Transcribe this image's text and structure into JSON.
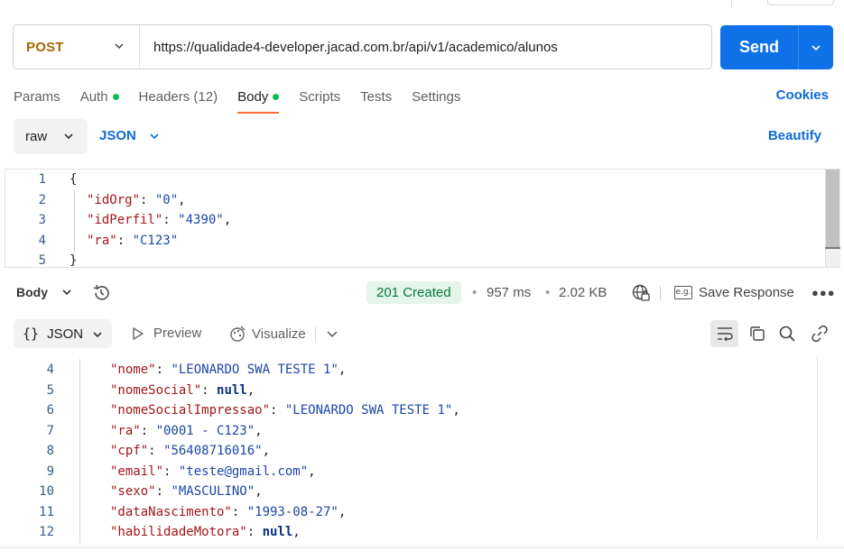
{
  "request": {
    "method": "POST",
    "url": "https://qualidade4-developer.jacad.com.br/api/v1/academico/alunos",
    "send_label": "Send"
  },
  "tabs": [
    {
      "label": "Params",
      "dot": false,
      "active": false
    },
    {
      "label": "Auth",
      "dot": true,
      "active": false
    },
    {
      "label": "Headers (12)",
      "dot": false,
      "active": false
    },
    {
      "label": "Body",
      "dot": true,
      "active": true
    },
    {
      "label": "Scripts",
      "dot": false,
      "active": false
    },
    {
      "label": "Tests",
      "dot": false,
      "active": false
    },
    {
      "label": "Settings",
      "dot": false,
      "active": false
    }
  ],
  "cookies_label": "Cookies",
  "body_mode": {
    "raw_label": "raw",
    "format_label": "JSON",
    "beautify_label": "Beautify"
  },
  "request_body": [
    {
      "n": "1",
      "parts": [
        {
          "t": "{",
          "c": "p"
        }
      ]
    },
    {
      "n": "2",
      "parts": [
        {
          "t": "\"idOrg\"",
          "c": "k"
        },
        {
          "t": ": ",
          "c": "p"
        },
        {
          "t": "\"0\"",
          "c": "s"
        },
        {
          "t": ",",
          "c": "p"
        }
      ]
    },
    {
      "n": "3",
      "parts": [
        {
          "t": "\"idPerfil\"",
          "c": "k"
        },
        {
          "t": ": ",
          "c": "p"
        },
        {
          "t": "\"4390\"",
          "c": "s"
        },
        {
          "t": ",",
          "c": "p"
        }
      ]
    },
    {
      "n": "4",
      "parts": [
        {
          "t": "\"ra\"",
          "c": "k"
        },
        {
          "t": ": ",
          "c": "p"
        },
        {
          "t": "\"C123\"",
          "c": "s"
        }
      ]
    },
    {
      "n": "5",
      "parts": [
        {
          "t": "}",
          "c": "p"
        }
      ]
    }
  ],
  "response": {
    "body_label": "Body",
    "status": "201 Created",
    "time": "957 ms",
    "size": "2.02 KB",
    "save_label": "Save Response",
    "format_label": "JSON",
    "preview_label": "Preview",
    "visualize_label": "Visualize",
    "eg_label": "e.g.",
    "lines": [
      {
        "n": "4",
        "parts": [
          {
            "t": "\"nome\"",
            "c": "k"
          },
          {
            "t": ": ",
            "c": "p"
          },
          {
            "t": "\"LEONARDO SWA TESTE 1\"",
            "c": "s"
          },
          {
            "t": ",",
            "c": "p"
          }
        ]
      },
      {
        "n": "5",
        "parts": [
          {
            "t": "\"nomeSocial\"",
            "c": "k"
          },
          {
            "t": ": ",
            "c": "p"
          },
          {
            "t": "null",
            "c": "n"
          },
          {
            "t": ",",
            "c": "p"
          }
        ]
      },
      {
        "n": "6",
        "parts": [
          {
            "t": "\"nomeSocialImpressao\"",
            "c": "k"
          },
          {
            "t": ": ",
            "c": "p"
          },
          {
            "t": "\"LEONARDO SWA TESTE 1\"",
            "c": "s"
          },
          {
            "t": ",",
            "c": "p"
          }
        ]
      },
      {
        "n": "7",
        "parts": [
          {
            "t": "\"ra\"",
            "c": "k"
          },
          {
            "t": ": ",
            "c": "p"
          },
          {
            "t": "\"0001 - C123\"",
            "c": "s"
          },
          {
            "t": ",",
            "c": "p"
          }
        ]
      },
      {
        "n": "8",
        "parts": [
          {
            "t": "\"cpf\"",
            "c": "k"
          },
          {
            "t": ": ",
            "c": "p"
          },
          {
            "t": "\"56408716016\"",
            "c": "s"
          },
          {
            "t": ",",
            "c": "p"
          }
        ]
      },
      {
        "n": "9",
        "parts": [
          {
            "t": "\"email\"",
            "c": "k"
          },
          {
            "t": ": ",
            "c": "p"
          },
          {
            "t": "\"teste@gmail.com\"",
            "c": "s"
          },
          {
            "t": ",",
            "c": "p"
          }
        ]
      },
      {
        "n": "10",
        "parts": [
          {
            "t": "\"sexo\"",
            "c": "k"
          },
          {
            "t": ": ",
            "c": "p"
          },
          {
            "t": "\"MASCULINO\"",
            "c": "s"
          },
          {
            "t": ",",
            "c": "p"
          }
        ]
      },
      {
        "n": "11",
        "parts": [
          {
            "t": "\"dataNascimento\"",
            "c": "k"
          },
          {
            "t": ": ",
            "c": "p"
          },
          {
            "t": "\"1993-08-27\"",
            "c": "s"
          },
          {
            "t": ",",
            "c": "p"
          }
        ]
      },
      {
        "n": "12",
        "parts": [
          {
            "t": "\"habilidadeMotora\"",
            "c": "k"
          },
          {
            "t": ": ",
            "c": "p"
          },
          {
            "t": "null",
            "c": "n"
          },
          {
            "t": ",",
            "c": "p"
          }
        ]
      }
    ]
  },
  "colors": {
    "accent": "#0f71e8",
    "method": "#a86500",
    "status_bg": "#e4f5ea",
    "status_text": "#0a7a3a",
    "tab_underline": "#ff6c37"
  },
  "icons": [
    "chevron-down-icon",
    "history-icon",
    "globe-icon",
    "more-icon",
    "braces-icon",
    "play-icon",
    "visualize-icon",
    "wrap-icon",
    "copy-icon",
    "search-icon",
    "link-icon"
  ]
}
